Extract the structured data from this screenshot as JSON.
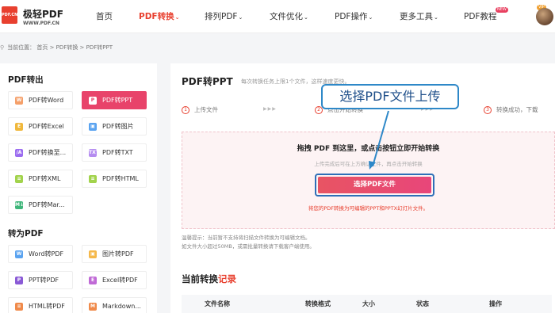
{
  "header": {
    "logo_mark": "PDF.CN",
    "logo_name": "极轻PDF",
    "logo_url": "WWW.PDF.CN",
    "nav": [
      {
        "label": "首页",
        "caret": ""
      },
      {
        "label": "PDF转换",
        "caret": "⌄"
      },
      {
        "label": "排列PDF",
        "caret": "⌄"
      },
      {
        "label": "文件优化",
        "caret": "⌄"
      },
      {
        "label": "PDF操作",
        "caret": "⌄"
      },
      {
        "label": "更多工具",
        "caret": "⌄"
      },
      {
        "label": "PDF教程",
        "caret": ""
      }
    ],
    "new_badge": "NEW",
    "vip_badge": "VIP"
  },
  "breadcrumb": "当前位置： 首页 > PDF转换 > PDF转PPT",
  "sidebar": {
    "section1_title": "PDF转出",
    "section1": [
      {
        "label": "PDF转Word",
        "icon": "W",
        "color": "#f5a06a"
      },
      {
        "label": "PDF转PPT",
        "icon": "P",
        "color": "#e8436a"
      },
      {
        "label": "PDF转Excel",
        "icon": "E",
        "color": "#f0b83c"
      },
      {
        "label": "PDF转图片",
        "icon": "▣",
        "color": "#5aa3f0"
      },
      {
        "label": "PDF转换至...",
        "icon": "/A",
        "color": "#9b6cf0"
      },
      {
        "label": "PDF转TXT",
        "icon": "TXT",
        "color": "#b58cf0"
      },
      {
        "label": "PDF转XML",
        "icon": "≡",
        "color": "#a2d34c"
      },
      {
        "label": "PDF转HTML",
        "icon": "≡",
        "color": "#a2d34c"
      },
      {
        "label": "PDF转Mar...",
        "icon": "M↓",
        "color": "#3fb67a"
      }
    ],
    "section2_title": "转为PDF",
    "section2": [
      {
        "label": "Word转PDF",
        "icon": "W",
        "color": "#5aa3f0"
      },
      {
        "label": "图片转PDF",
        "icon": "▣",
        "color": "#f5b84a"
      },
      {
        "label": "PPT转PDF",
        "icon": "P",
        "color": "#8a5ad6"
      },
      {
        "label": "Excel转PDF",
        "icon": "E",
        "color": "#c06ad6"
      },
      {
        "label": "HTML转PDF",
        "icon": "≡",
        "color": "#f08a4a"
      },
      {
        "label": "Markdown...",
        "icon": "M",
        "color": "#f08a4a"
      }
    ]
  },
  "main": {
    "title": "PDF转PPT",
    "subtitle": "每次转换任务上限1个文件，这样速度更快。",
    "steps": [
      {
        "num": "1",
        "label": "上传文件"
      },
      {
        "num": "2",
        "label": "点击开始转换"
      },
      {
        "num": "3",
        "label": "转换成功，下载"
      }
    ],
    "step_arrows": "▶▶▶",
    "drop_title": "拖拽 PDF 到这里，或点击按钮立即开始转换",
    "drop_sub": "上传完成后可在上方确认文件，再点击开始转换",
    "choose_button": "选择PDF文件",
    "drop_note": "将您的PDF转换为可编辑的PPT和PPTX幻灯片文件。",
    "tip1": "温馨提示：当前暂不支持将扫描文件转换为可编辑文档。",
    "tip2": "如文件大小超过50MB，或需批量转换请下载客户端使用。",
    "records_title_a": "当前转换",
    "records_title_b": "记录",
    "table_headers": [
      "文件名称",
      "转换格式",
      "大小",
      "状态",
      "操作"
    ]
  },
  "annotation": {
    "callout_text": "选择PDF文件上传"
  },
  "colors": {
    "brand_red": "#e8402f",
    "accent_pink": "#e8436a",
    "annotation_blue": "#2e88c8"
  }
}
